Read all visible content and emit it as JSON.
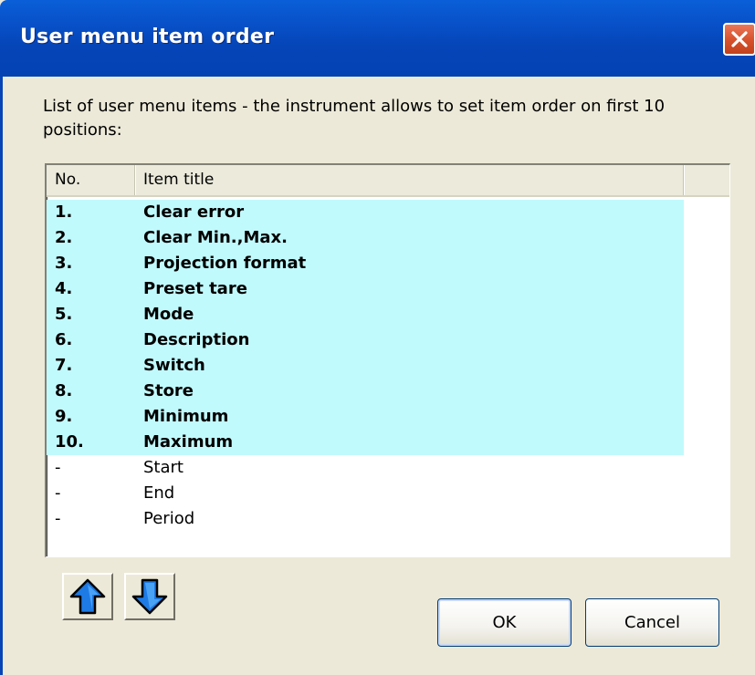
{
  "window": {
    "title": "User menu item order",
    "close_icon": "close-icon"
  },
  "description": "List of user menu items - the instrument allows to set item order on first 10 positions:",
  "list": {
    "columns": [
      "No.",
      "Item title",
      ""
    ],
    "rows": [
      {
        "no": "1.",
        "title": "Clear error",
        "selected": true
      },
      {
        "no": "2.",
        "title": "Clear Min.,Max.",
        "selected": true
      },
      {
        "no": "3.",
        "title": "Projection format",
        "selected": true
      },
      {
        "no": "4.",
        "title": "Preset tare",
        "selected": true
      },
      {
        "no": "5.",
        "title": "Mode",
        "selected": true
      },
      {
        "no": "6.",
        "title": "Description",
        "selected": true
      },
      {
        "no": "7.",
        "title": "Switch",
        "selected": true
      },
      {
        "no": "8.",
        "title": "Store",
        "selected": true
      },
      {
        "no": "9.",
        "title": "Minimum",
        "selected": true
      },
      {
        "no": "10.",
        "title": "Maximum",
        "selected": true
      },
      {
        "no": "-",
        "title": "Start",
        "selected": false
      },
      {
        "no": "-",
        "title": "End",
        "selected": false
      },
      {
        "no": "-",
        "title": "Period",
        "selected": false
      }
    ]
  },
  "buttons": {
    "move_up_icon": "arrow-up-icon",
    "move_down_icon": "arrow-down-icon",
    "ok": "OK",
    "cancel": "Cancel"
  },
  "colors": {
    "titlebar": "#0545b8",
    "selection": "#c1fafd",
    "arrow_fill": "#1e7be6",
    "dialog_bg": "#ece9d8"
  }
}
